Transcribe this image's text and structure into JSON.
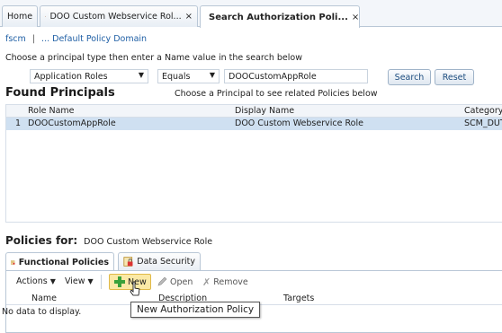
{
  "tabs": [
    {
      "label": "Home"
    },
    {
      "label": "DOO Custom Webservice Rol...",
      "close": "×"
    },
    {
      "label": "Search Authorization Poli...",
      "close": "×"
    }
  ],
  "breadcrumb": {
    "root": "fscm",
    "separator": "|",
    "domain": "... Default Policy Domain"
  },
  "search": {
    "instructions": "Choose a principal type then enter a Name value in the search below",
    "principal_type": "Application Roles",
    "operator": "Equals",
    "name_value": "DOOCustomAppRole",
    "search_label": "Search",
    "reset_label": "Reset"
  },
  "found": {
    "title": "Found Principals",
    "hint": "Choose a Principal to see related Policies below",
    "columns": [
      "Role Name",
      "Display Name",
      "Category"
    ],
    "rows": [
      {
        "index": "1",
        "role_name": "DOOCustomAppRole",
        "display_name": "DOO Custom Webservice Role",
        "category": "SCM_DUTY"
      }
    ]
  },
  "policies": {
    "title": "Policies for:",
    "principal": "DOO Custom Webservice Role",
    "tabs": [
      {
        "label": "Functional Policies"
      },
      {
        "label": "Data Security"
      }
    ],
    "toolbar": {
      "actions": "Actions",
      "view": "View",
      "new": "New",
      "open": "Open",
      "remove": "Remove"
    },
    "columns": [
      "Name",
      "Description",
      "Targets"
    ],
    "empty": "No data to display.",
    "tooltip": "New Authorization Policy"
  },
  "colors": {
    "accent": "#1f5fa5",
    "selected_row": "#cfe0f1",
    "new_icon": "#3aa13a"
  }
}
